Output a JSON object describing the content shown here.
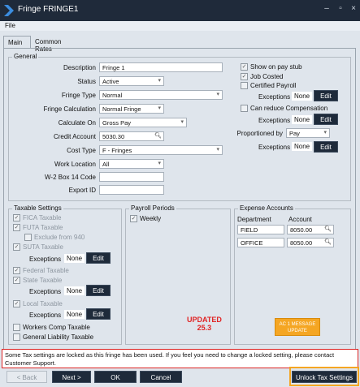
{
  "window": {
    "title": "Fringe FRINGE1",
    "controls": [
      "–",
      "▫",
      "×"
    ]
  },
  "menu": {
    "file": "File"
  },
  "tabs": [
    "Main",
    "Common Rates"
  ],
  "general": {
    "legend": "General",
    "fields": {
      "description": {
        "label": "Description",
        "value": "Fringe 1"
      },
      "status": {
        "label": "Status",
        "value": "Active"
      },
      "fringe_type": {
        "label": "Fringe Type",
        "value": "Normal"
      },
      "fringe_calc": {
        "label": "Fringe Calculation",
        "value": "Normal Fringe"
      },
      "calculate_on": {
        "label": "Calculate On",
        "value": "Gross Pay"
      },
      "credit_account": {
        "label": "Credit Account",
        "value": "5030.30"
      },
      "cost_type": {
        "label": "Cost Type",
        "value": "F - Fringes"
      },
      "work_location": {
        "label": "Work Location",
        "value": "All"
      },
      "w2_box14": {
        "label": "W-2 Box 14 Code",
        "value": ""
      },
      "export_id": {
        "label": "Export ID",
        "value": ""
      }
    },
    "checks": {
      "show_on_stub": {
        "label": "Show on pay stub",
        "checked": true
      },
      "job_costed": {
        "label": "Job Costed",
        "checked": true
      },
      "certified_payroll": {
        "label": "Certified Payroll",
        "checked": false
      },
      "can_reduce_comp": {
        "label": "Can reduce Compensation",
        "checked": false
      }
    },
    "exceptions_label": "Exceptions",
    "none": "None",
    "edit": "Edit",
    "proportioned_by": {
      "label": "Proportioned by",
      "value": "Pay"
    }
  },
  "taxable": {
    "legend": "Taxable Settings",
    "fica": "FICA Taxable",
    "futa": "FUTA Taxable",
    "exclude_940": "Exclude from 940",
    "suta": "SUTA Taxable",
    "federal": "Federal Taxable",
    "state": "State Taxable",
    "local": "Local Taxable",
    "workers_comp": "Workers Comp Taxable",
    "general_liability": "General Liability Taxable"
  },
  "payroll_periods": {
    "legend": "Payroll Periods",
    "weekly": "Weekly"
  },
  "expense": {
    "legend": "Expense Accounts",
    "col_department": "Department",
    "col_account": "Account",
    "rows": [
      {
        "department": "FIELD",
        "account": "8050.00"
      },
      {
        "department": "OFFICE",
        "account": "8050.00"
      }
    ]
  },
  "annotation": {
    "updated": "UPDATED",
    "version": "25.3",
    "callout": "AC 1 MESSAGE UPDATE"
  },
  "notice": "Some Tax settings are locked as this fringe has been used. If you feel you need to change a locked setting, please contact Customer Support.",
  "footer": {
    "back": "< Back",
    "next": "Next >",
    "ok": "OK",
    "cancel": "Cancel",
    "unlock": "Unlock Tax Settings"
  }
}
